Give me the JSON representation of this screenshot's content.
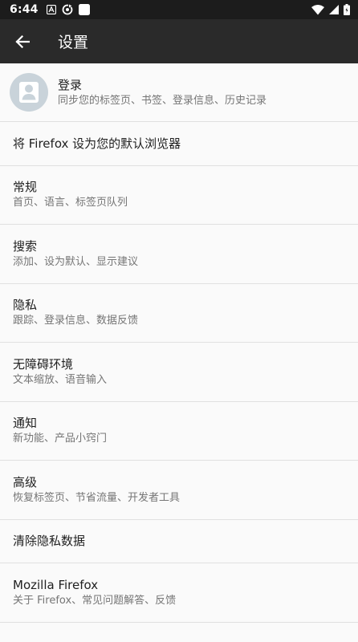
{
  "status_bar": {
    "time": "6:44"
  },
  "app_bar": {
    "title": "设置"
  },
  "account": {
    "title": "登录",
    "subtitle": "同步您的标签页、书签、登录信息、历史记录"
  },
  "settings": [
    {
      "title": "将 Firefox 设为您的默认浏览器",
      "subtitle": ""
    },
    {
      "title": "常规",
      "subtitle": "首页、语言、标签页队列"
    },
    {
      "title": "搜索",
      "subtitle": "添加、设为默认、显示建议"
    },
    {
      "title": "隐私",
      "subtitle": "跟踪、登录信息、数据反馈"
    },
    {
      "title": "无障碍环境",
      "subtitle": "文本缩放、语音输入"
    },
    {
      "title": "通知",
      "subtitle": "新功能、产品小窍门"
    },
    {
      "title": "高级",
      "subtitle": "恢复标签页、节省流量、开发者工具"
    },
    {
      "title": "清除隐私数据",
      "subtitle": ""
    },
    {
      "title": "Mozilla Firefox",
      "subtitle": "关于 Firefox、常见问题解答、反馈"
    }
  ],
  "icons": {
    "back": "arrow-left-icon",
    "avatar": "user-silhouette-icon",
    "wifi": "wifi-icon",
    "signal": "cellular-signal-icon",
    "battery": "battery-icon"
  }
}
